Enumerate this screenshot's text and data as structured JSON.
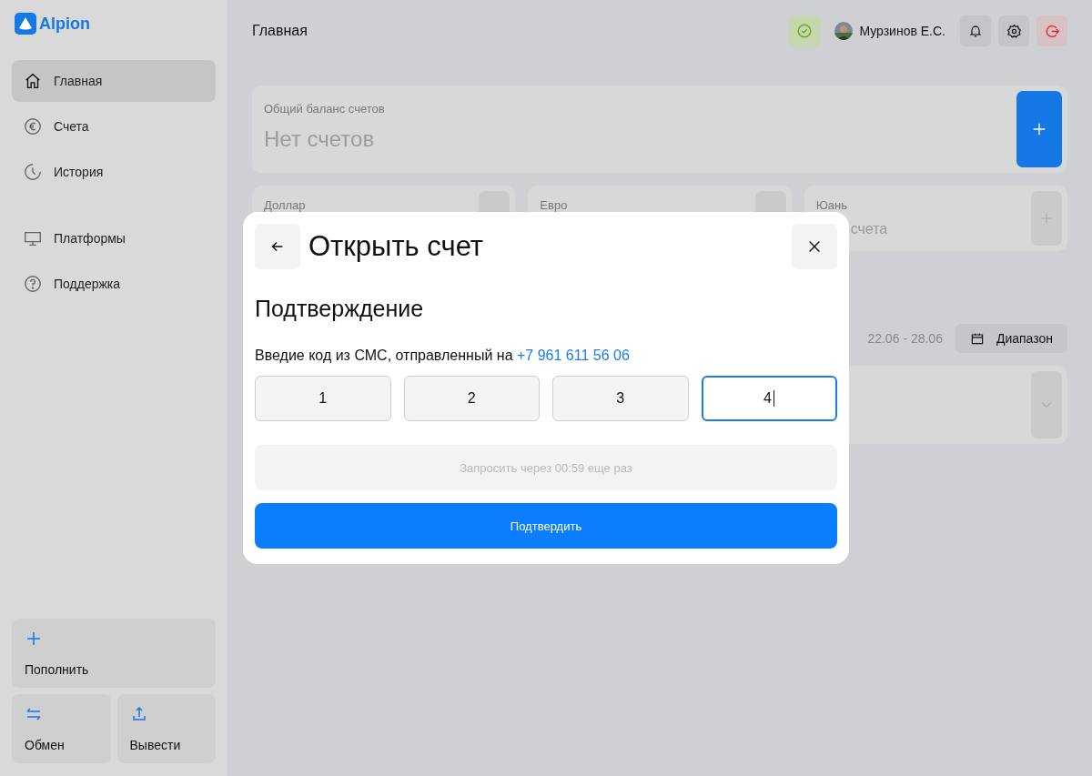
{
  "logo": {
    "text": "Alpion"
  },
  "sidebar": {
    "items": [
      {
        "label": "Главная",
        "selected": true
      },
      {
        "label": "Счета",
        "selected": false
      },
      {
        "label": "История",
        "selected": false
      },
      {
        "label": "Платформы",
        "selected": false
      },
      {
        "label": "Поддержка",
        "selected": false
      }
    ],
    "actions": [
      {
        "label": "Пополнить"
      },
      {
        "label": "Обмен"
      },
      {
        "label": "Вывести"
      }
    ]
  },
  "header": {
    "title": "Главная",
    "user": "Мурзинов Е.С."
  },
  "balance": {
    "label": "Общий баланс счетов",
    "value": "Нет счетов"
  },
  "currencies": [
    {
      "label": "Доллар"
    },
    {
      "label": "Евро"
    },
    {
      "label": "Юань",
      "value": "счета"
    }
  ],
  "range": {
    "dates": "22.06 - 28.06",
    "button": "Диапазон"
  },
  "modal": {
    "title": "Открыть счет",
    "subtitle": "Подтверждение",
    "prompt": "Введие код из СМС, отправленный на",
    "phone": "+7 961 611 56 06",
    "code": [
      {
        "value": "1",
        "selected": false
      },
      {
        "value": "2",
        "selected": false
      },
      {
        "value": "3",
        "selected": false
      },
      {
        "value": "4",
        "selected": true
      }
    ],
    "resend": {
      "label": "Запросить через 00:59 еще раз",
      "disabled": true
    },
    "confirm": "Подтвердить"
  }
}
